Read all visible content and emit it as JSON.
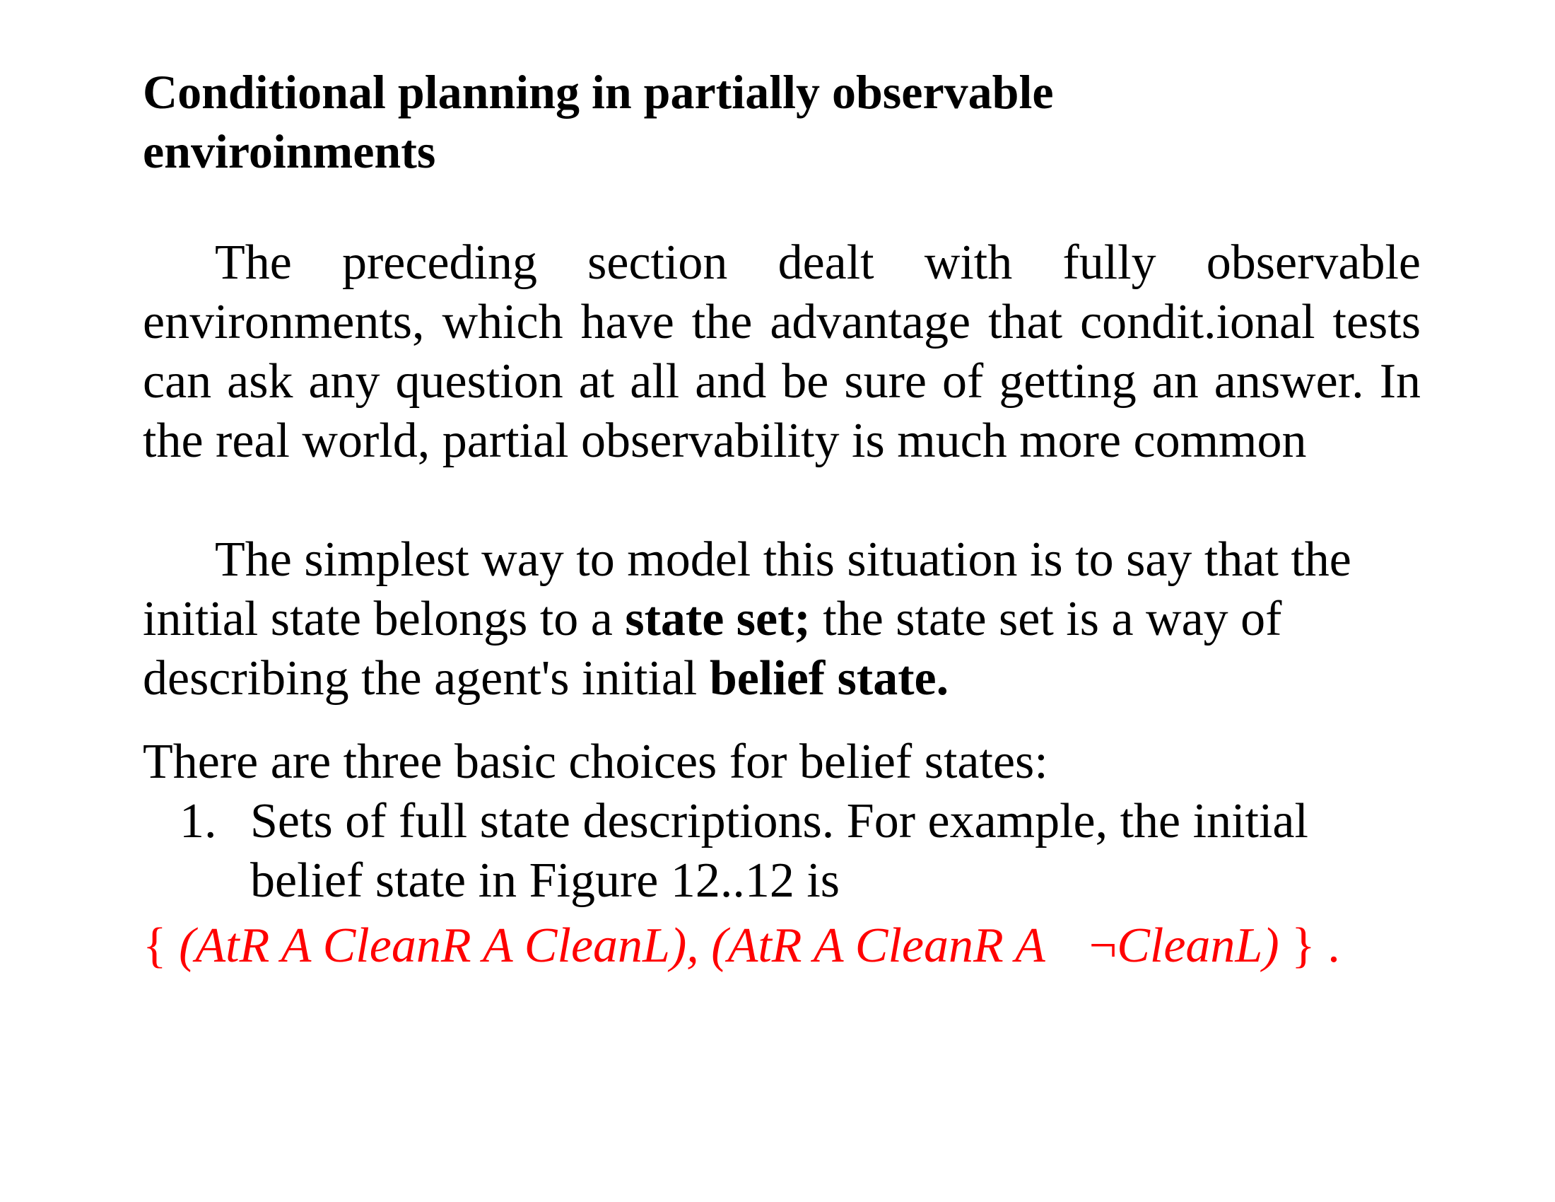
{
  "title": "Conditional planning in partially observable enviroinments",
  "paragraph1": "The preceding section dealt with fully observable environments, which have the advantage that condit.ional tests can ask any question at all and be sure of getting an answer. In the real world, partial observability is much more common",
  "paragraph2": {
    "part1": "The simplest way to model this situation is to say that the initial state belongs to a ",
    "bold1": "state set;",
    "part2": " the state set is a way of describing the agent's initial ",
    "bold2": "belief state."
  },
  "choices_intro": "There are three basic choices for belief states:",
  "list": [
    {
      "number": "1.",
      "text": "Sets of full state descriptions. For example, the initial belief state in Figure 12..12 is"
    }
  ],
  "formula": {
    "open_brace": "{ ",
    "part1": "(AtR A CleanR A CleanL), (AtR A CleanR A",
    "neg_symbol": "¬",
    "part2": "CleanL)",
    "close_brace": " } .",
    "color": "#ff0000"
  }
}
